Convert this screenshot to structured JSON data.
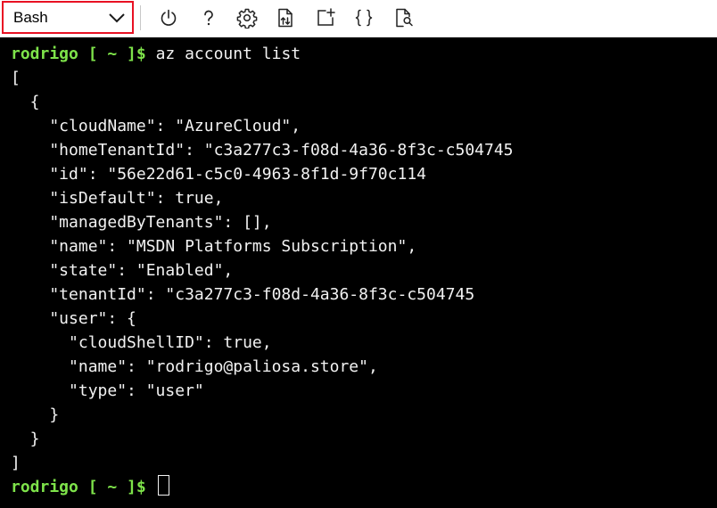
{
  "toolbar": {
    "shell_selector": {
      "selected": "Bash"
    },
    "buttons": [
      {
        "name": "restart-button",
        "icon": "power-icon"
      },
      {
        "name": "help-button",
        "icon": "question-mark-icon"
      },
      {
        "name": "settings-button",
        "icon": "gear-icon"
      },
      {
        "name": "upload-download-button",
        "icon": "file-transfer-icon"
      },
      {
        "name": "new-session-button",
        "icon": "new-window-icon"
      },
      {
        "name": "editor-button",
        "icon": "braces-icon"
      },
      {
        "name": "web-preview-button",
        "icon": "preview-icon"
      }
    ],
    "accent_color": "#e81123"
  },
  "terminal": {
    "prompt_color": "#7ee34a",
    "text_color": "#f2f2f2",
    "background": "#000000",
    "command_prompt": {
      "user": "rodrigo",
      "path": " [ ~ ]$ ",
      "command": "az account list"
    },
    "output": [
      "[",
      "  {",
      "    \"cloudName\": \"AzureCloud\",",
      "    \"homeTenantId\": \"c3a277c3-f08d-4a36-8f3c-c504745",
      "    \"id\": \"56e22d61-c5c0-4963-8f1d-9f70c114",
      "    \"isDefault\": true,",
      "    \"managedByTenants\": [],",
      "    \"name\": \"MSDN Platforms Subscription\",",
      "    \"state\": \"Enabled\",",
      "    \"tenantId\": \"c3a277c3-f08d-4a36-8f3c-c504745",
      "    \"user\": {",
      "      \"cloudShellID\": true,",
      "      \"name\": \"rodrigo@paliosa.store\",",
      "      \"type\": \"user\"",
      "    }",
      "  }",
      "]"
    ],
    "final_prompt": {
      "user": "rodrigo",
      "path": " [ ~ ]$ "
    }
  }
}
